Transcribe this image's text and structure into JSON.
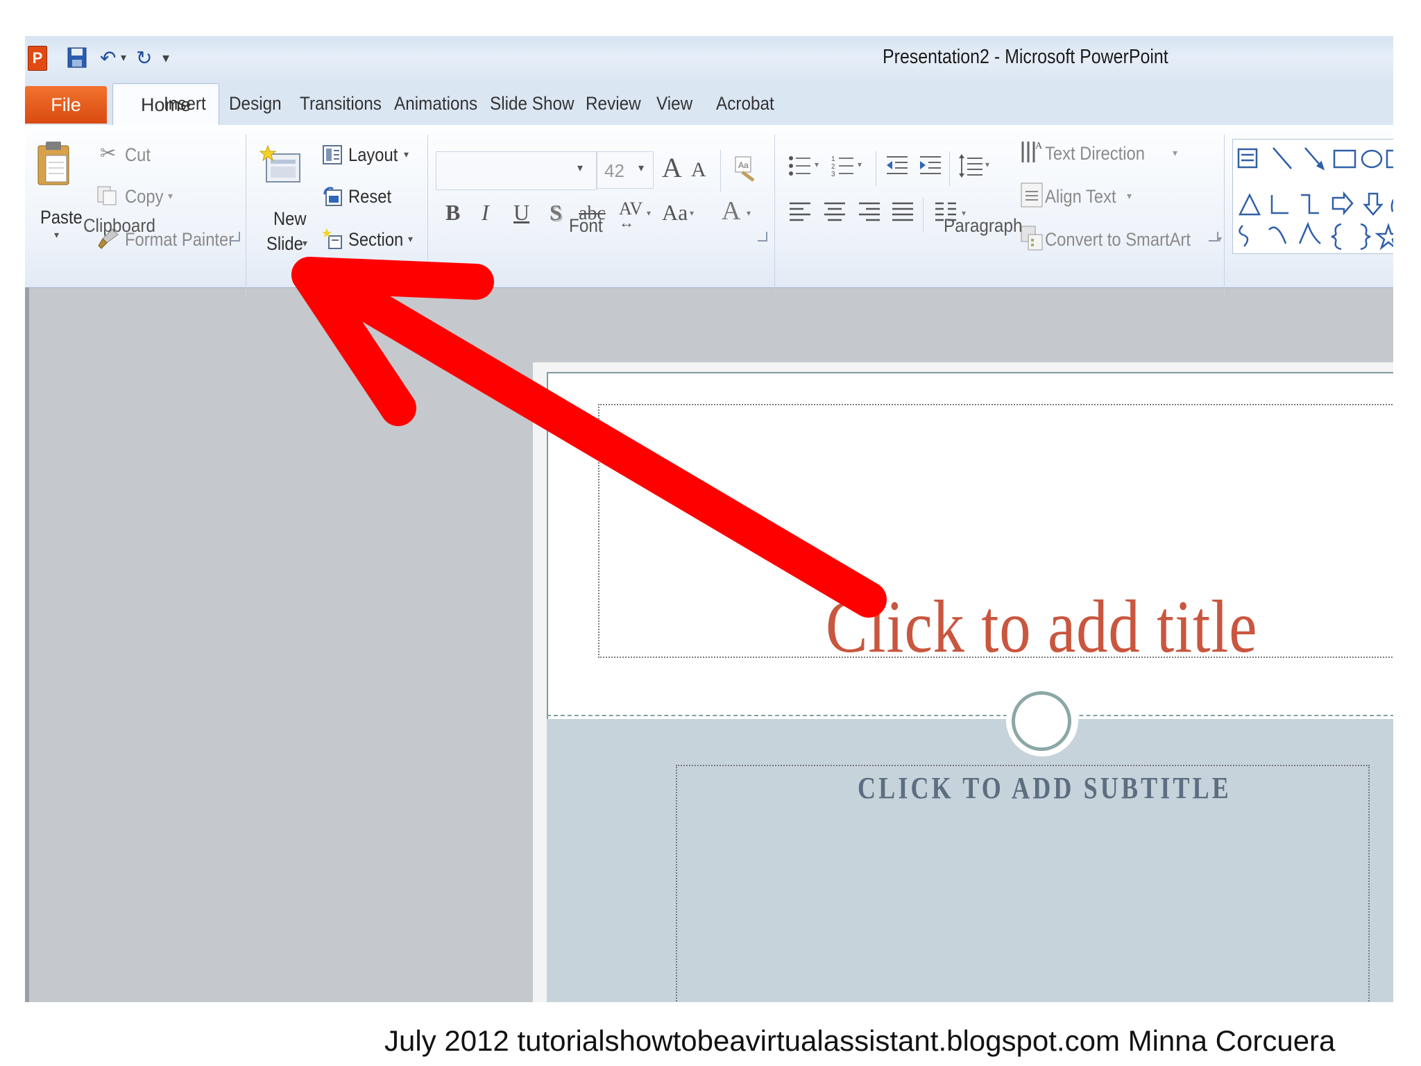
{
  "window": {
    "title": "Presentation2  -  Microsoft PowerPoint"
  },
  "tabs": {
    "file": "File",
    "home": "Home",
    "items": [
      "Insert",
      "Design",
      "Transitions",
      "Animations",
      "Slide Show",
      "Review",
      "View",
      "Acrobat"
    ]
  },
  "clipboard": {
    "paste": "Paste",
    "cut": "Cut",
    "copy": "Copy",
    "format_painter": "Format Painter",
    "label": "Clipboard"
  },
  "slides": {
    "new_slide_line1": "New",
    "new_slide_line2": "Slide",
    "layout": "Layout",
    "reset": "Reset",
    "section": "Section"
  },
  "font": {
    "name_value": "",
    "size_value": "42",
    "label": "Font",
    "bold": "B",
    "italic": "I",
    "underline": "U",
    "shadow": "S",
    "strike": "abc",
    "spacing": "AV",
    "case": "Aa",
    "color": "A",
    "grow": "A",
    "shrink": "A"
  },
  "paragraph": {
    "text_direction": "Text Direction",
    "align_text": "Align Text",
    "convert_smartart": "Convert to SmartArt",
    "label": "Paragraph"
  },
  "slide": {
    "title_placeholder": "Click to add title",
    "subtitle_placeholder": "CLICK TO ADD SUBTITLE"
  },
  "caption": "July 2012   tutorialshowtobeavirtualassistant.blogspot.com Minna Corcuera",
  "colors": {
    "file_tab": "#d94a10",
    "arrow": "#ff0000",
    "title_text": "#c9563e",
    "subtitle_text": "#5d6e80"
  },
  "icons": [
    "powerpoint-app-icon",
    "save-icon",
    "undo-icon",
    "redo-icon",
    "customize-qat-icon",
    "scissors-icon",
    "copy-icon",
    "paintbrush-icon",
    "clipboard-icon",
    "new-slide-icon",
    "layout-icon",
    "reset-icon",
    "section-icon",
    "bullets-icon",
    "numbering-icon",
    "indent-icon",
    "line-spacing-icon",
    "align-left-icon",
    "align-center-icon",
    "align-right-icon",
    "justify-icon",
    "columns-icon"
  ]
}
